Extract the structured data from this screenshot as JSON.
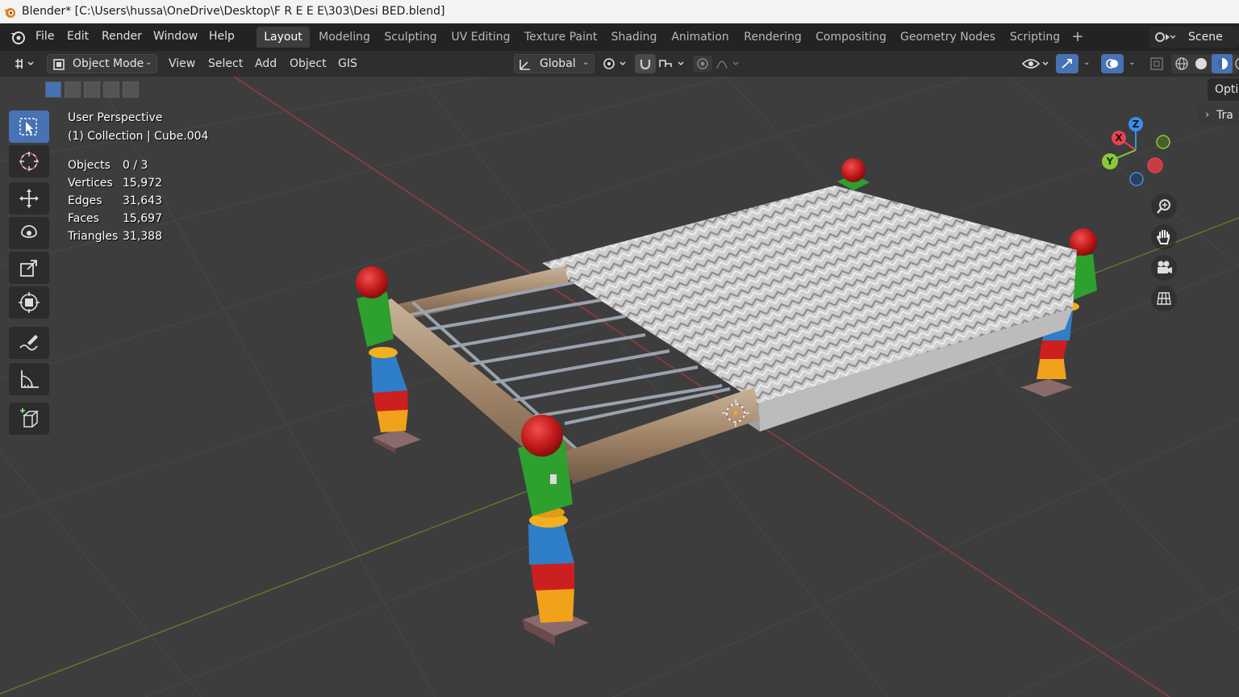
{
  "titlebar": {
    "text": "Blender* [C:\\Users\\hussa\\OneDrive\\Desktop\\F R E E E\\303\\Desi BED.blend]"
  },
  "menu": {
    "file": "File",
    "edit": "Edit",
    "render": "Render",
    "window": "Window",
    "help": "Help"
  },
  "workspaces": [
    "Layout",
    "Modeling",
    "Sculpting",
    "UV Editing",
    "Texture Paint",
    "Shading",
    "Animation",
    "Rendering",
    "Compositing",
    "Geometry Nodes",
    "Scripting"
  ],
  "scene": {
    "label": "Scene"
  },
  "header": {
    "mode": "Object Mode",
    "view": "View",
    "select": "Select",
    "add": "Add",
    "object": "Object",
    "gis": "GIS",
    "orientation": "Global",
    "options_label": "Optio",
    "transform_label": "Tra"
  },
  "viewport": {
    "perspective": "User Perspective",
    "collection": "(1) Collection | Cube.004",
    "stats": [
      {
        "label": "Objects",
        "value": "0 / 3"
      },
      {
        "label": "Vertices",
        "value": "15,972"
      },
      {
        "label": "Edges",
        "value": "31,643"
      },
      {
        "label": "Faces",
        "value": "15,697"
      },
      {
        "label": "Triangles",
        "value": "31,388"
      }
    ]
  },
  "gizmo": {
    "x": "X",
    "y": "Y",
    "z": "Z"
  },
  "colors": {
    "accent": "#4772b3",
    "x_axis": "#e34550",
    "y_axis": "#8bc93a",
    "z_axis": "#3d8ee5"
  },
  "icons": [
    "blender-logo-icon",
    "select-box-icon",
    "cursor-icon",
    "move-icon",
    "rotate-icon",
    "scale-icon",
    "transform-icon",
    "annotate-icon",
    "measure-icon",
    "add-cube-icon",
    "zoom-icon",
    "hand-pan-icon",
    "camera-icon",
    "grid-view-icon"
  ]
}
